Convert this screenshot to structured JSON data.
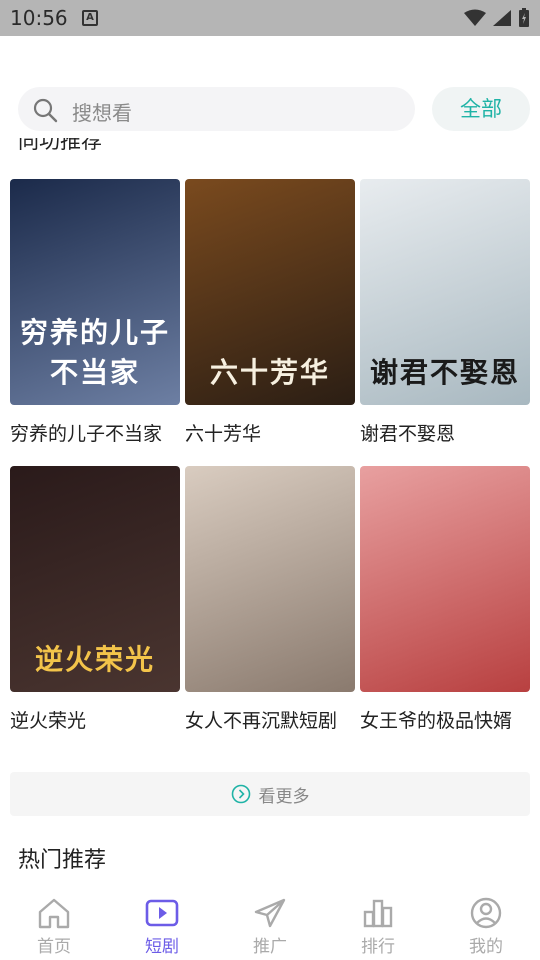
{
  "status_bar": {
    "time": "10:56"
  },
  "search": {
    "placeholder": "搜想看",
    "all_label": "全部"
  },
  "section_partial_label": "同功推荐",
  "dramas": [
    {
      "title": "穷养的儿子不当家",
      "poster_text": "穷养的儿子不当家",
      "colors": [
        "#1b2a4a",
        "#6d7fa3"
      ],
      "text_color": "#ffffff"
    },
    {
      "title": "六十芳华",
      "poster_text": "六十芳华",
      "colors": [
        "#7a4a1e",
        "#2b1e14"
      ],
      "text_color": "#f7f0e0"
    },
    {
      "title": "谢君不娶恩",
      "poster_text": "谢君不娶恩",
      "colors": [
        "#e8ecef",
        "#a8b8c0"
      ],
      "text_color": "#1a1a1a"
    },
    {
      "title": "逆火荣光",
      "poster_text": "逆火荣光",
      "colors": [
        "#2a1a1a",
        "#4a3530"
      ],
      "text_color": "#f3c44a"
    },
    {
      "title": "女人不再沉默短剧",
      "poster_text": "",
      "colors": [
        "#d9ccc0",
        "#8a7a6e"
      ],
      "text_color": "#ffffff"
    },
    {
      "title": "女王爷的极品快婿",
      "poster_text": "",
      "colors": [
        "#e8a0a0",
        "#b84040"
      ],
      "text_color": "#ffffff"
    }
  ],
  "see_more_label": "看更多",
  "hot_section_title": "热门推荐",
  "nav": [
    {
      "label": "首页",
      "icon": "home-icon",
      "active": false
    },
    {
      "label": "短剧",
      "icon": "play-icon",
      "active": true
    },
    {
      "label": "推广",
      "icon": "send-icon",
      "active": false
    },
    {
      "label": "排行",
      "icon": "bar-chart-icon",
      "active": false
    },
    {
      "label": "我的",
      "icon": "profile-icon",
      "active": false
    }
  ],
  "colors": {
    "accent": "#6c5ce7",
    "teal": "#1fb3a6"
  }
}
